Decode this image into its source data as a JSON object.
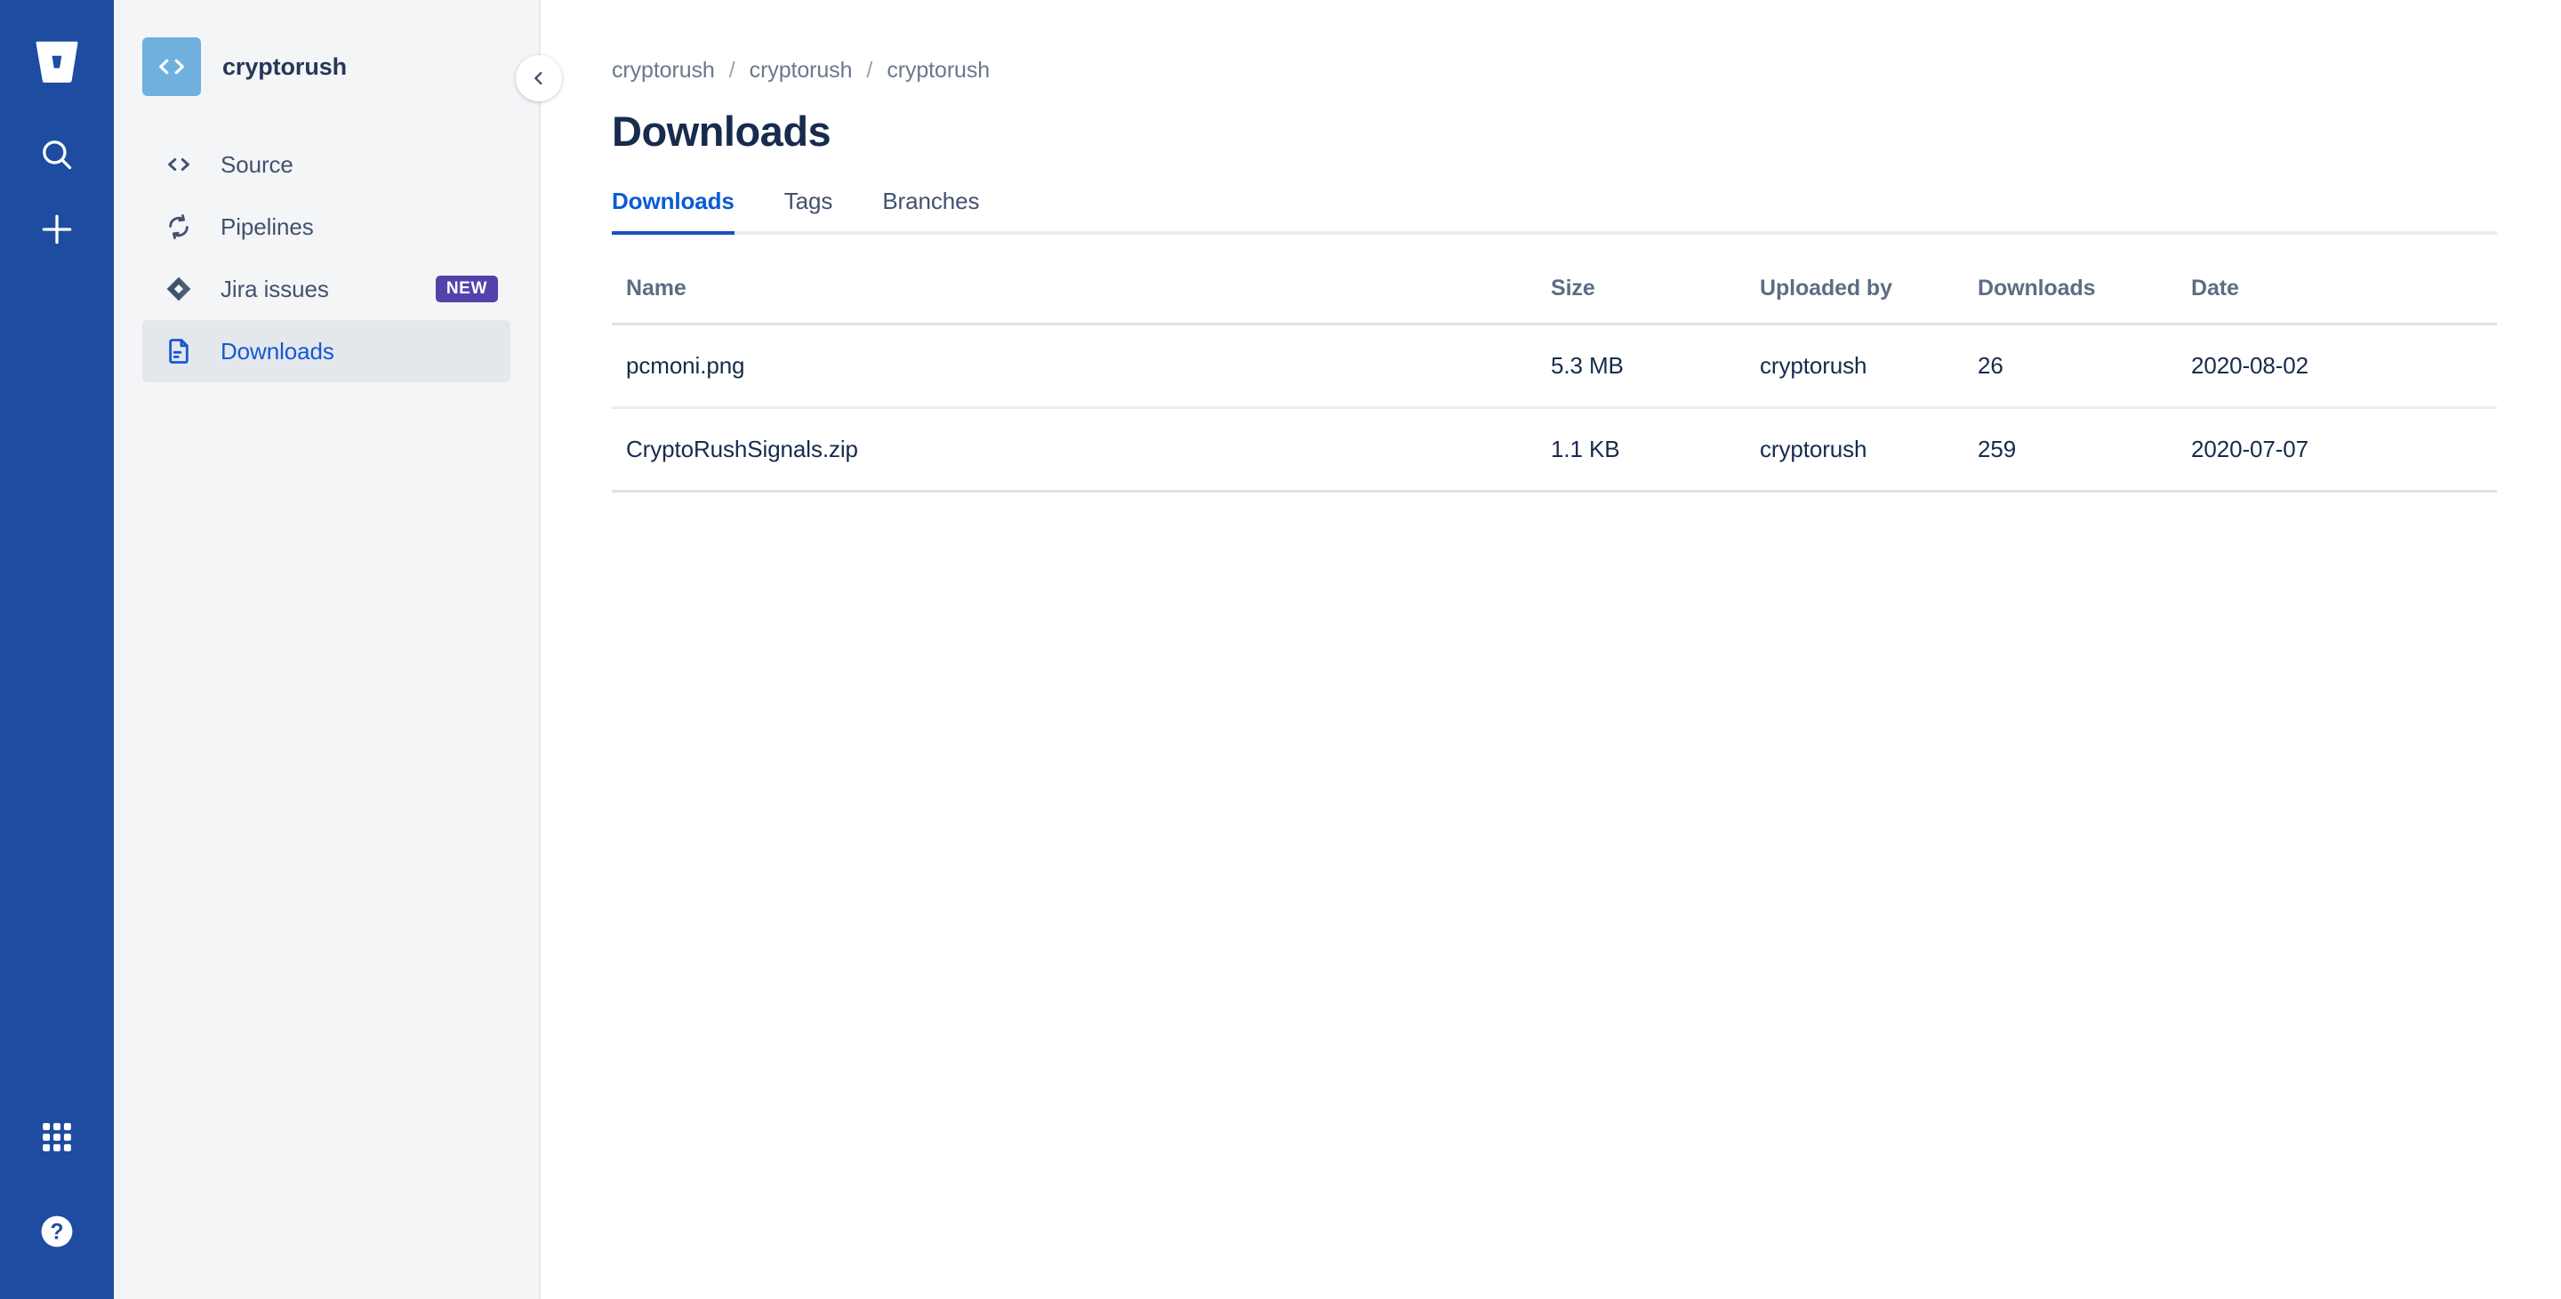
{
  "rail": {
    "logo_icon": "bitbucket-logo-icon",
    "search_icon": "search-icon",
    "create_icon": "plus-icon",
    "appswitcher_icon": "app-switcher-grid-icon",
    "help_icon": "help-question-icon"
  },
  "sidebar": {
    "repo_name": "cryptorush",
    "repo_avatar_icon": "code-brackets-icon",
    "collapse_icon": "chevron-left-icon",
    "items": [
      {
        "label": "Source",
        "icon": "code-brackets-icon",
        "active": false,
        "badge": ""
      },
      {
        "label": "Pipelines",
        "icon": "pipelines-sync-icon",
        "active": false,
        "badge": ""
      },
      {
        "label": "Jira issues",
        "icon": "jira-diamond-icon",
        "active": false,
        "badge": "NEW"
      },
      {
        "label": "Downloads",
        "icon": "file-document-icon",
        "active": true,
        "badge": ""
      }
    ]
  },
  "breadcrumb": {
    "items": [
      "cryptorush",
      "cryptorush",
      "cryptorush"
    ],
    "separator": "/"
  },
  "page": {
    "title": "Downloads"
  },
  "tabs": [
    {
      "label": "Downloads",
      "active": true
    },
    {
      "label": "Tags",
      "active": false
    },
    {
      "label": "Branches",
      "active": false
    }
  ],
  "table": {
    "headers": [
      "Name",
      "Size",
      "Uploaded by",
      "Downloads",
      "Date"
    ],
    "rows": [
      {
        "name": "pcmoni.png",
        "size": "5.3 MB",
        "uploaded_by": "cryptorush",
        "downloads": "26",
        "date": "2020-08-02"
      },
      {
        "name": "CryptoRushSignals.zip",
        "size": "1.1 KB",
        "uploaded_by": "cryptorush",
        "downloads": "259",
        "date": "2020-07-07"
      }
    ]
  },
  "colors": {
    "rail_bg": "#1D4CA0",
    "sidebar_bg": "#F4F5F7",
    "accent_blue": "#1558D6",
    "badge_purple": "#5243AA",
    "text_dark": "#172B4D",
    "text_muted": "#6B778C",
    "avatar_blue": "#6FB0DE"
  }
}
